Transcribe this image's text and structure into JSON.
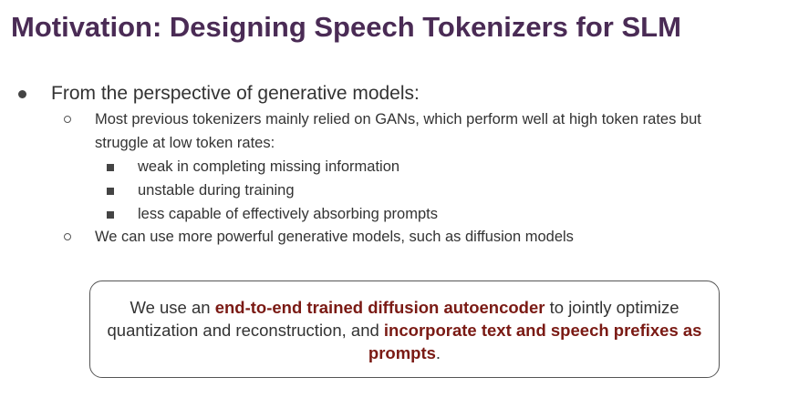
{
  "slide": {
    "title": "Motivation: Designing Speech Tokenizers for SLM"
  },
  "bullets": {
    "level1": "From the perspective of generative models:",
    "sub1_line1": "Most previous tokenizers mainly relied on GANs, which perform well at high token rates but",
    "sub1_line2": "struggle at low token rates:",
    "sub1_items": [
      "weak in completing missing information",
      "unstable during training",
      "less capable of effectively absorbing prompts"
    ],
    "sub2": "We can use more powerful generative models, such as diffusion models"
  },
  "callout": {
    "part1": "We use an ",
    "highlight1": "end-to-end trained diffusion autoencoder",
    "part2": " to jointly optimize quantization and reconstruction, and ",
    "highlight2": "incorporate text and speech prefixes as prompts",
    "part3": "."
  },
  "colors": {
    "title": "#4a2b55",
    "highlight": "#7a1a14",
    "body_text": "#333333"
  }
}
